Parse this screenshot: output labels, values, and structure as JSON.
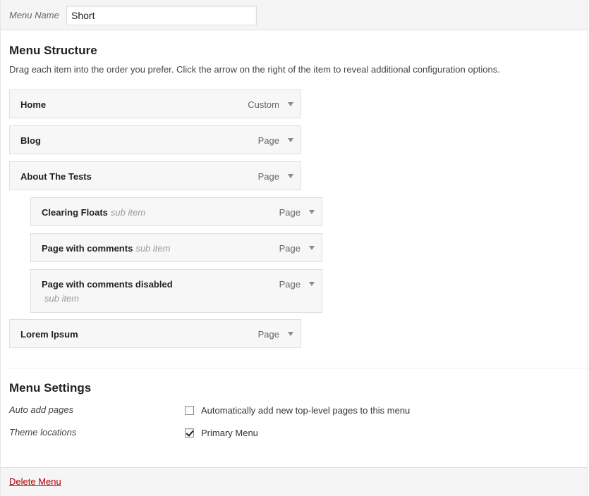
{
  "header": {
    "menu_name_label": "Menu Name",
    "menu_name_value": "Short"
  },
  "structure": {
    "title": "Menu Structure",
    "description": "Drag each item into the order you prefer. Click the arrow on the right of the item to reveal additional configuration options."
  },
  "items": [
    {
      "title": "Home",
      "type": "Custom",
      "sub": ""
    },
    {
      "title": "Blog",
      "type": "Page",
      "sub": ""
    },
    {
      "title": "About The Tests",
      "type": "Page",
      "sub": ""
    },
    {
      "title": "Clearing Floats",
      "type": "Page",
      "sub": "sub item"
    },
    {
      "title": "Page with comments",
      "type": "Page",
      "sub": "sub item"
    },
    {
      "title": "Page with comments disabled",
      "type": "Page",
      "sub": "sub item"
    },
    {
      "title": "Lorem Ipsum",
      "type": "Page",
      "sub": ""
    }
  ],
  "settings": {
    "title": "Menu Settings",
    "auto_add_label": "Auto add pages",
    "auto_add_text": "Automatically add new top-level pages to this menu",
    "auto_add_checked": false,
    "theme_locations_label": "Theme locations",
    "primary_menu_text": "Primary Menu",
    "primary_menu_checked": true
  },
  "footer": {
    "delete_label": "Delete Menu"
  },
  "colors": {
    "delete_link": "#aa0000",
    "item_bg": "#f7f7f7",
    "header_bg": "#f5f5f5"
  }
}
